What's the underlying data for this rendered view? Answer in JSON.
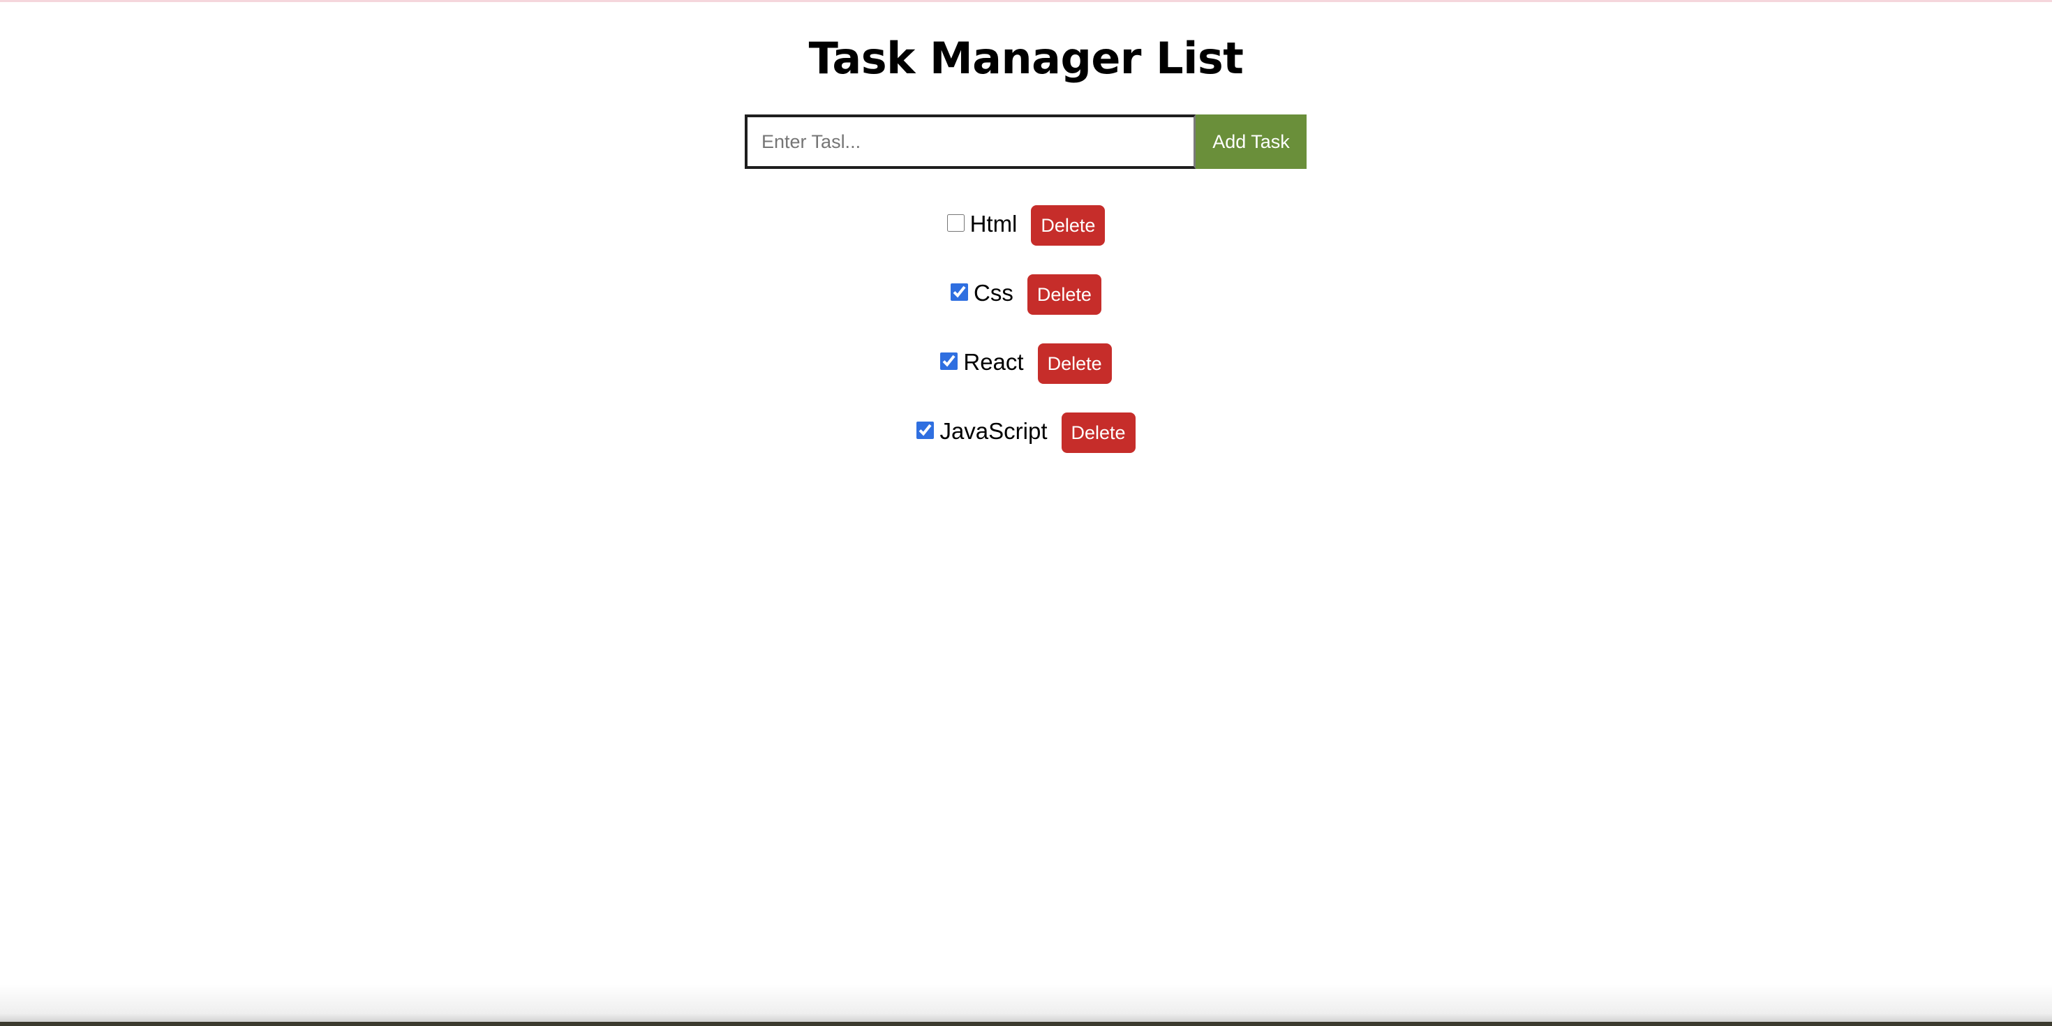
{
  "app": {
    "title": "Task Manager List"
  },
  "add_form": {
    "input_placeholder": "Enter Tasl...",
    "input_value": "",
    "add_label": "Add Task"
  },
  "tasks": [
    {
      "label": "Html",
      "checked": false,
      "delete_label": "Delete"
    },
    {
      "label": "Css",
      "checked": true,
      "delete_label": "Delete"
    },
    {
      "label": "React",
      "checked": true,
      "delete_label": "Delete"
    },
    {
      "label": "JavaScript",
      "checked": true,
      "delete_label": "Delete"
    }
  ],
  "colors": {
    "add_button": "#6a8f3a",
    "delete_button": "#c62d2a",
    "checkbox_accent": "#2f6fe0"
  }
}
